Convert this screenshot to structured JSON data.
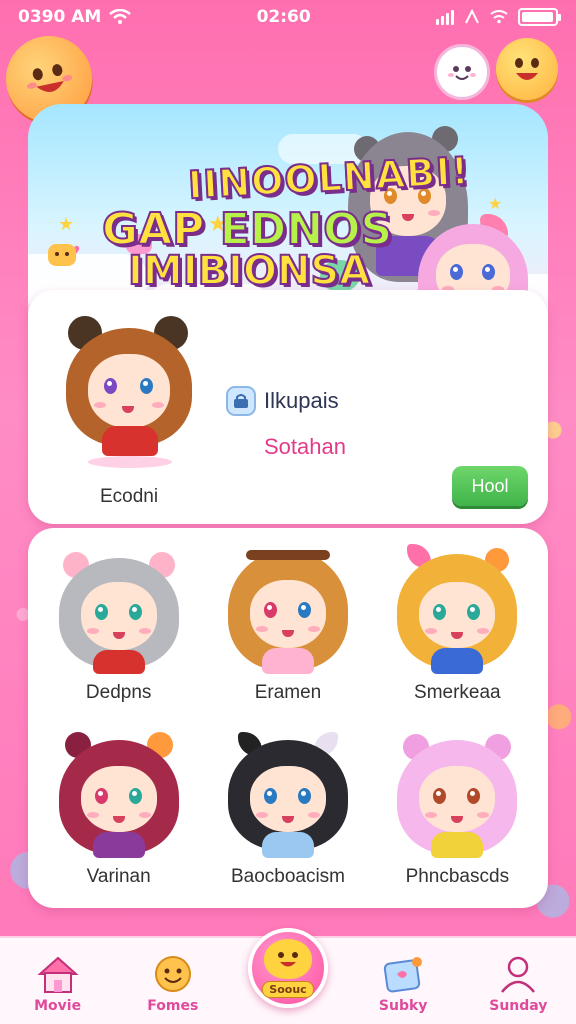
{
  "status_bar": {
    "time_left": "0390 AM",
    "time_center": "02:60"
  },
  "hero": {
    "title_line1": "IINOOLNABI!",
    "title_line2a": "GAP ",
    "title_line2b": "EDNOS",
    "title_line3": "IMIBIONSA"
  },
  "featured": {
    "name": "Ecodni",
    "info_label": "Ilkupais",
    "info_sub": "Sotahan",
    "button_label": "Hool"
  },
  "grid": {
    "items": [
      {
        "name": "Dedpns"
      },
      {
        "name": "Eramen"
      },
      {
        "name": "Smerkeaa"
      },
      {
        "name": "Varinan"
      },
      {
        "name": "Baocboacism"
      },
      {
        "name": "Phncbascds"
      }
    ]
  },
  "bottom_nav": {
    "items": [
      {
        "label": "Movie",
        "icon": "house-icon"
      },
      {
        "label": "Fomes",
        "icon": "smiley-icon"
      },
      {
        "label": "Soouc",
        "icon": "character-icon"
      },
      {
        "label": "Subky",
        "icon": "card-icon"
      },
      {
        "label": "Sunday",
        "icon": "person-icon"
      }
    ]
  },
  "colors": {
    "background": "#ff6fb0",
    "accent_pink": "#e23b8a",
    "button_green": "#4fc24a",
    "title_yellow": "#ffe23f",
    "title_outline": "#7b2d8c"
  }
}
